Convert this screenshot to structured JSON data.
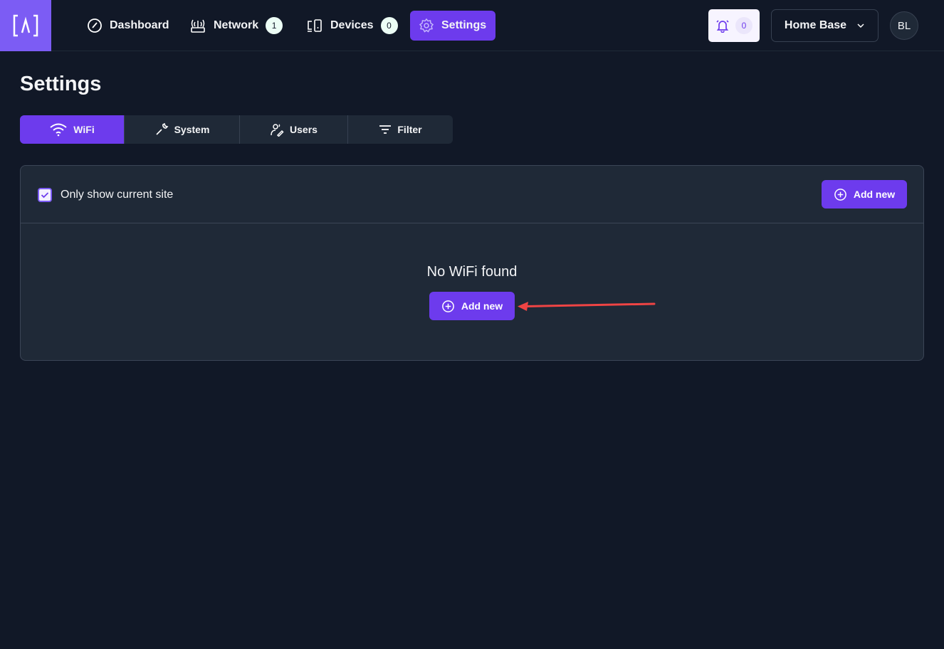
{
  "header": {
    "nav": [
      {
        "label": "Dashboard",
        "icon": "gauge-icon"
      },
      {
        "label": "Network",
        "icon": "router-icon",
        "badge": "1"
      },
      {
        "label": "Devices",
        "icon": "devices-icon",
        "badge": "0"
      },
      {
        "label": "Settings",
        "icon": "gear-icon"
      }
    ],
    "notifications_count": "0",
    "site_selector": "Home Base",
    "avatar_initials": "BL"
  },
  "page": {
    "title": "Settings"
  },
  "tabs": [
    {
      "label": "WiFi",
      "icon": "wifi-icon"
    },
    {
      "label": "System",
      "icon": "wrench-icon"
    },
    {
      "label": "Users",
      "icon": "user-edit-icon"
    },
    {
      "label": "Filter",
      "icon": "filter-icon"
    }
  ],
  "panel": {
    "checkbox_label": "Only show current site",
    "checkbox_checked": true,
    "add_new_label": "Add new",
    "empty_message": "No WiFi found",
    "empty_add_label": "Add new"
  },
  "colors": {
    "accent": "#6d3bed",
    "background": "#111827",
    "panel": "#1f2937",
    "annotation": "#ef4444"
  }
}
